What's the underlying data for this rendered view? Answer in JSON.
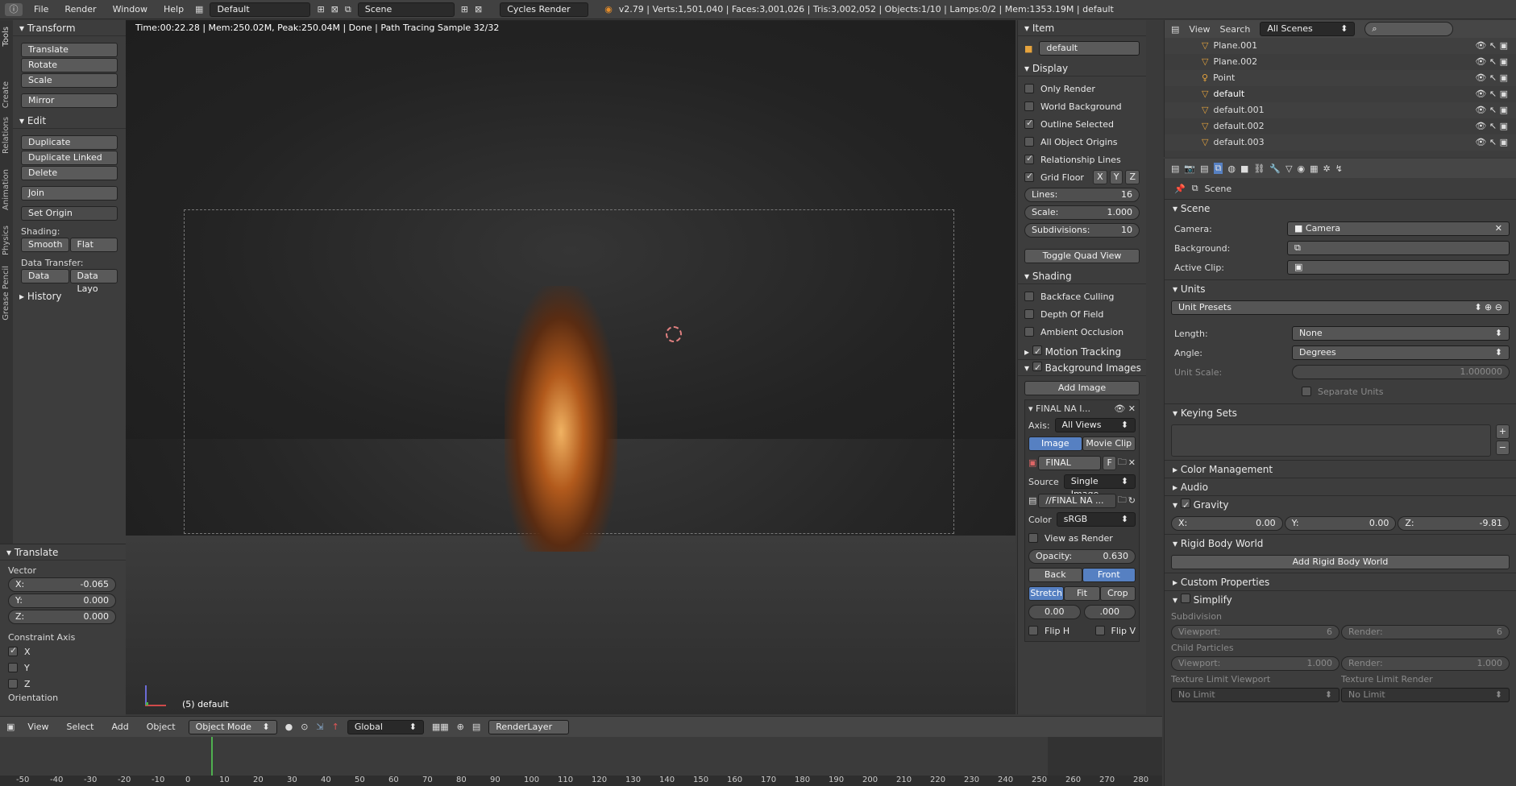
{
  "topbar": {
    "menus": [
      "File",
      "Render",
      "Window",
      "Help"
    ],
    "layout": "Default",
    "scene": "Scene",
    "engine": "Cycles Render",
    "info": "v2.79 | Verts:1,501,040 | Faces:3,001,026 | Tris:3,002,052 | Objects:1/10 | Lamps:0/2 | Mem:1353.19M | default"
  },
  "toolshelf": {
    "tabs": [
      "Tools",
      "Create",
      "Relations",
      "Animation",
      "Physics",
      "Grease Pencil"
    ],
    "transform": {
      "title": "Transform",
      "buttons": [
        "Translate",
        "Rotate",
        "Scale",
        "Mirror"
      ]
    },
    "edit": {
      "title": "Edit",
      "buttons": [
        "Duplicate",
        "Duplicate Linked",
        "Delete",
        "Join"
      ],
      "set_origin": "Set Origin",
      "shading_label": "Shading:",
      "smooth": "Smooth",
      "flat": "Flat",
      "data_transfer_label": "Data Transfer:",
      "data": "Data",
      "data_layo": "Data Layo"
    },
    "history": "History",
    "operator": {
      "title": "Translate",
      "vector_label": "Vector",
      "x": "-0.065",
      "y": "0.000",
      "z": "0.000",
      "constraint_label": "Constraint Axis",
      "cx": "X",
      "cy": "Y",
      "cz": "Z",
      "orientation": "Orientation"
    }
  },
  "viewport": {
    "status": "Time:00:22.28 | Mem:250.02M, Peak:250.04M | Done | Path Tracing Sample 32/32",
    "object_label": "(5) default"
  },
  "npanel": {
    "item": "Item",
    "item_name": "default",
    "display": "Display",
    "checks": [
      {
        "label": "Only Render",
        "on": false
      },
      {
        "label": "World Background",
        "on": false
      },
      {
        "label": "Outline Selected",
        "on": true
      },
      {
        "label": "All Object Origins",
        "on": false
      },
      {
        "label": "Relationship Lines",
        "on": true
      }
    ],
    "grid_floor": "Grid Floor",
    "gx": "X",
    "gy": "Y",
    "gz": "Z",
    "lines_label": "Lines:",
    "lines": "16",
    "scale_label": "Scale:",
    "scale": "1.000",
    "subdiv_label": "Subdivisions:",
    "subdiv": "10",
    "toggle_quad": "Toggle Quad View",
    "shading": "Shading",
    "shading_checks": [
      "Backface Culling",
      "Depth Of Field",
      "Ambient Occlusion"
    ],
    "motion_tracking": "Motion Tracking",
    "background_images": "Background Images",
    "add_image": "Add Image",
    "bg_name": "FINAL NA I...",
    "axis_label": "Axis:",
    "axis": "All Views",
    "image": "Image",
    "movie_clip": "Movie Clip",
    "final": "FINAL",
    "f": "F",
    "source_label": "Source",
    "source": "Single Image",
    "path": "//FINAL NA ...",
    "color_label": "Color",
    "color": "sRGB",
    "view_as_render": "View as Render",
    "opacity_label": "Opacity:",
    "opacity": "0.630",
    "back": "Back",
    "front": "Front",
    "stretch": "Stretch",
    "fit": "Fit",
    "crop": "Crop",
    "off1": "0.00",
    "off2": ".000",
    "flip_h": "Flip H",
    "flip_v": "Flip V"
  },
  "viewheader": {
    "menus": [
      "View",
      "Select",
      "Add",
      "Object"
    ],
    "mode": "Object Mode",
    "orientation": "Global",
    "renderlayer": "RenderLayer"
  },
  "timeline": {
    "ticks": [
      "-50",
      "-40",
      "-30",
      "-20",
      "-10",
      "0",
      "10",
      "20",
      "30",
      "40",
      "50",
      "60",
      "70",
      "80",
      "90",
      "100",
      "110",
      "120",
      "130",
      "140",
      "150",
      "160",
      "170",
      "180",
      "190",
      "200",
      "210",
      "220",
      "230",
      "240",
      "250",
      "260",
      "270",
      "280"
    ]
  },
  "outliner": {
    "view": "View",
    "search": "Search",
    "scenes": "All Scenes",
    "rows": [
      "Plane.001",
      "Plane.002",
      "Point",
      "default",
      "default.001",
      "default.002",
      "default.003"
    ]
  },
  "properties": {
    "breadcrumb": "Scene",
    "scene": "Scene",
    "camera_label": "Camera:",
    "camera": "Camera",
    "background_label": "Background:",
    "active_clip_label": "Active Clip:",
    "units": "Units",
    "unit_presets": "Unit Presets",
    "length_label": "Length:",
    "length": "None",
    "angle_label": "Angle:",
    "angle": "Degrees",
    "unit_scale_label": "Unit Scale:",
    "unit_scale": "1.000000",
    "separate_units": "Separate Units",
    "keying_sets": "Keying Sets",
    "color_management": "Color Management",
    "audio": "Audio",
    "gravity": "Gravity",
    "gx": "0.00",
    "gy": "0.00",
    "gz": "-9.81",
    "gxl": "X:",
    "gyl": "Y:",
    "gzl": "Z:",
    "rigid_body_world": "Rigid Body World",
    "add_rigid": "Add Rigid Body World",
    "custom_props": "Custom Properties",
    "simplify": "Simplify",
    "subdivision": "Subdivision",
    "viewport_label": "Viewport:",
    "viewport_val": "6",
    "render_label": "Render:",
    "render_val": "6",
    "child_particles": "Child Particles",
    "cp_viewport": "1.000",
    "cp_render": "1.000",
    "tex_lim_viewport": "Texture Limit Viewport",
    "tex_lim_render": "Texture Limit Render",
    "no_limit": "No Limit"
  }
}
